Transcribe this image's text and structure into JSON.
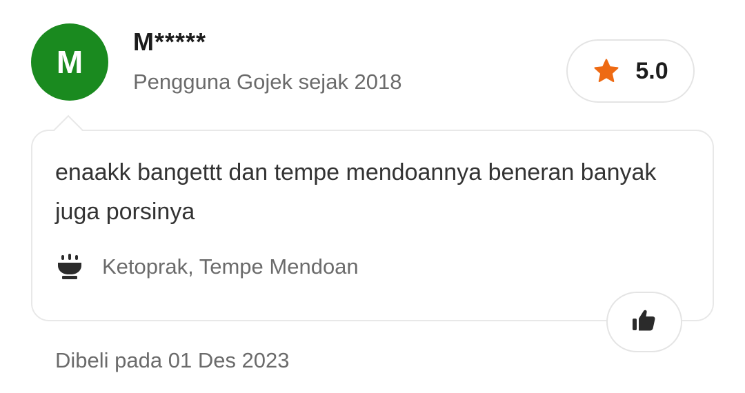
{
  "reviewer": {
    "avatar_initial": "M",
    "avatar_color": "#1a8a1f",
    "name": "M*****",
    "member_since": "Pengguna Gojek sejak 2018"
  },
  "rating": {
    "icon": "star-icon",
    "star_color": "#ee6a13",
    "value": "5.0"
  },
  "review": {
    "text": "enaakk bangettt dan tempe mendoannya beneran banyak juga porsinya",
    "dish_icon": "bowl-icon",
    "dishes": "Ketoprak, Tempe Mendoan"
  },
  "actions": {
    "like_icon": "thumbs-up-icon"
  },
  "footer": {
    "purchase_date": "Dibeli pada 01 Des 2023"
  }
}
